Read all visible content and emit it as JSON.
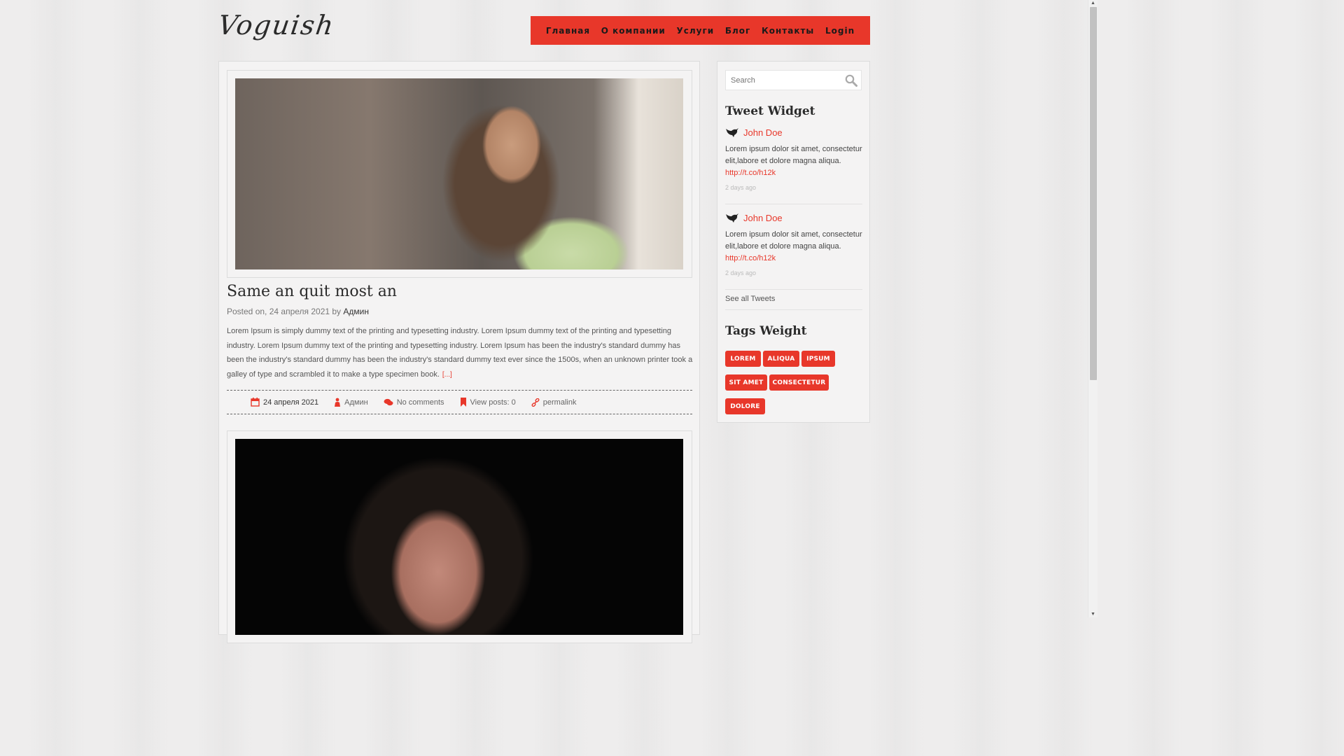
{
  "site": {
    "logo": "Voguish"
  },
  "nav": {
    "items": [
      "Главная",
      "О компании",
      "Услуги",
      "Блог",
      "Контакты",
      "Login"
    ],
    "accent_color": "#e8372a"
  },
  "post": {
    "title": "Same an quit most an",
    "posted_prefix": "Posted on, 24 апреля 2021 by",
    "author": "Админ",
    "body": "Lorem Ipsum is simply dummy text of the printing and typesetting industry. Lorem Ipsum dummy text of the printing and typesetting industry. Lorem Ipsum dummy text of the printing and typesetting industry. Lorem Ipsum has been the industry's standard dummy has been the industry's standard dummy has been the industry's standard dummy text ever since the 1500s, when an unknown printer took a galley of type and scrambled it to make a type specimen book.",
    "more": "[...]",
    "info": {
      "date": "24 апреля 2021",
      "author": "Админ",
      "comments": "No comments",
      "views": "View posts: 0",
      "permalink": "permalink"
    },
    "icons": [
      "calendar-icon",
      "user-icon",
      "comments-icon",
      "bookmark-icon",
      "link-icon"
    ]
  },
  "sidebar": {
    "search_placeholder": "Search",
    "tweet_widget_title": "Tweet Widget",
    "tweets": [
      {
        "name": "John Doe",
        "text": "Lorem ipsum dolor sit amet, consectetur elit,labore et dolore magna aliqua.",
        "link": "http://t.co/h12k",
        "time": "2 days ago"
      },
      {
        "name": "John Doe",
        "text": "Lorem ipsum dolor sit amet, consectetur elit,labore et dolore magna aliqua.",
        "link": "http://t.co/h12k",
        "time": "2 days ago"
      }
    ],
    "see_all": "See all Tweets",
    "tags_title": "Tags Weight",
    "tags": [
      "LOREM",
      "ALIQUA",
      "IPSUM",
      "SIT AMET",
      "CONSECTETUR",
      "DOLORE"
    ]
  }
}
